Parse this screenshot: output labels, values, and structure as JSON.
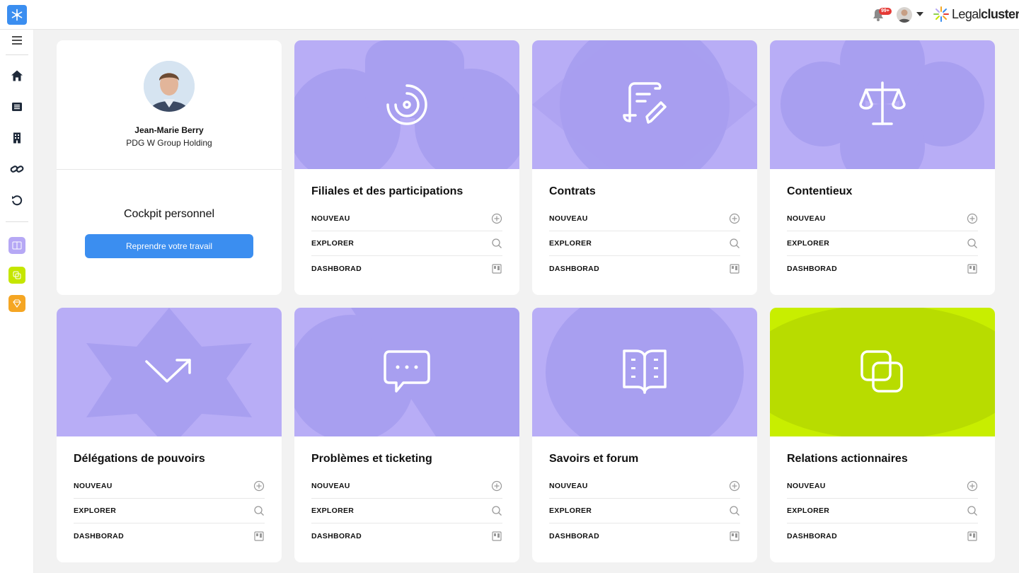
{
  "header": {
    "notification_badge": "99+",
    "brand_light": "Legal",
    "brand_bold": "cluster"
  },
  "sidebar": {
    "items": [
      {
        "icon": "menu-icon"
      },
      {
        "icon": "home-icon"
      },
      {
        "icon": "newspaper-icon"
      },
      {
        "icon": "building-icon"
      },
      {
        "icon": "link-icon"
      },
      {
        "icon": "history-icon"
      }
    ],
    "modules": [
      {
        "icon": "book-icon",
        "color": "#b6a8f5"
      },
      {
        "icon": "copy-icon",
        "color": "#c5e600"
      },
      {
        "icon": "diamond-icon",
        "color": "#f5a623"
      }
    ]
  },
  "profile": {
    "name": "Jean-Marie Berry",
    "role": "PDG W Group Holding",
    "cockpit_title": "Cockpit personnel",
    "resume_label": "Reprendre votre travail"
  },
  "actions": {
    "new": "NOUVEAU",
    "explore": "EXPLORER",
    "dashboard": "DASHBORAD"
  },
  "modules": [
    {
      "title": "Filiales et des participations",
      "icon": "target-icon",
      "color": "#b8adf6"
    },
    {
      "title": "Contrats",
      "icon": "contract-edit-icon",
      "color": "#b8adf6"
    },
    {
      "title": "Contentieux",
      "icon": "scales-icon",
      "color": "#b8adf6"
    },
    {
      "title": "Délégations de pouvoirs",
      "icon": "arrow-trend-icon",
      "color": "#b8adf6"
    },
    {
      "title": "Problèmes et ticketing",
      "icon": "chat-bubble-icon",
      "color": "#b8adf6"
    },
    {
      "title": "Savoirs et forum",
      "icon": "open-book-icon",
      "color": "#b8adf6"
    },
    {
      "title": "Relations actionnaires",
      "icon": "copy-icon",
      "color": "#c8ee00"
    }
  ]
}
